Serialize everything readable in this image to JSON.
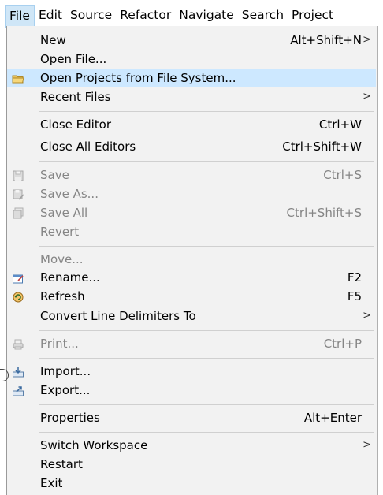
{
  "menubar": {
    "items": [
      {
        "label": "File"
      },
      {
        "label": "Edit"
      },
      {
        "label": "Source"
      },
      {
        "label": "Refactor"
      },
      {
        "label": "Navigate"
      },
      {
        "label": "Search"
      },
      {
        "label": "Project"
      }
    ]
  },
  "menu": {
    "submenu_arrow": ">",
    "items": [
      {
        "label": "New",
        "accelerator": "Alt+Shift+N"
      },
      {
        "label": "Open File..."
      },
      {
        "label": "Open Projects from File System...",
        "icon": "folder-icon"
      },
      {
        "label": "Recent Files"
      },
      {
        "label": "Close Editor",
        "accelerator": "Ctrl+W"
      },
      {
        "label": "Close All Editors",
        "accelerator": "Ctrl+Shift+W"
      },
      {
        "label": "Save",
        "accelerator": "Ctrl+S",
        "icon": "save-icon"
      },
      {
        "label": "Save As...",
        "icon": "save-as-icon"
      },
      {
        "label": "Save All",
        "accelerator": "Ctrl+Shift+S",
        "icon": "save-all-icon"
      },
      {
        "label": "Revert"
      },
      {
        "label": "Move..."
      },
      {
        "label": "Rename...",
        "accelerator": "F2",
        "icon": "rename-icon"
      },
      {
        "label": "Refresh",
        "accelerator": "F5",
        "icon": "refresh-icon"
      },
      {
        "label": "Convert Line Delimiters To"
      },
      {
        "label": "Print...",
        "accelerator": "Ctrl+P",
        "icon": "print-icon"
      },
      {
        "label": "Import...",
        "icon": "import-icon"
      },
      {
        "label": "Export...",
        "icon": "export-icon"
      },
      {
        "label": "Properties",
        "accelerator": "Alt+Enter"
      },
      {
        "label": "Switch Workspace"
      },
      {
        "label": "Restart"
      },
      {
        "label": "Exit"
      }
    ]
  },
  "colors": {
    "menu_background": "#f2f2f2",
    "highlight": "#cde8ff",
    "active_menu": "#cfe6f7",
    "disabled_text": "#858585"
  }
}
